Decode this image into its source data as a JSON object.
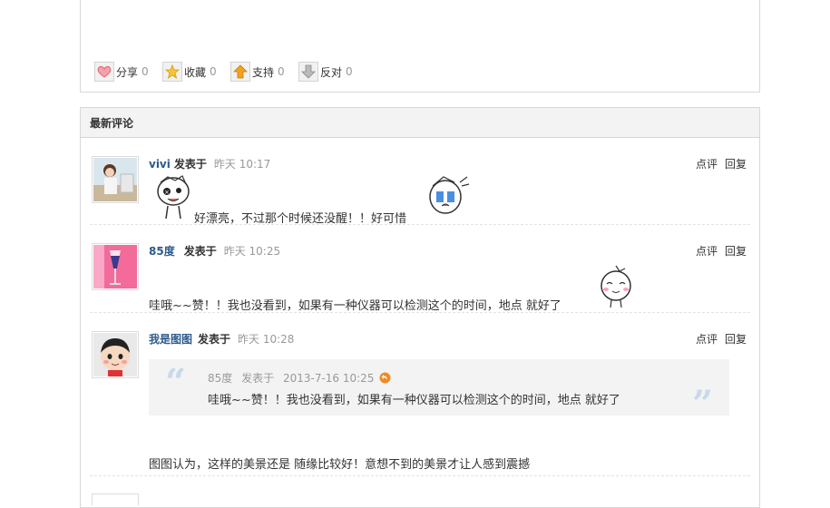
{
  "actions": [
    {
      "label": "分享",
      "count": "0",
      "icon": "heart-icon"
    },
    {
      "label": "收藏",
      "count": "0",
      "icon": "star-icon"
    },
    {
      "label": "支持",
      "count": "0",
      "icon": "arrow-up-icon"
    },
    {
      "label": "反对",
      "count": "0",
      "icon": "arrow-down-icon"
    }
  ],
  "comments_section": {
    "title": "最新评论",
    "comments": [
      {
        "user": "vivi",
        "posted_label": "发表于",
        "time": "昨天 10:17",
        "text": "好漂亮，不过那个时候还没醒！！好可惜",
        "ops": [
          "点评",
          "回复"
        ]
      },
      {
        "user": "85度",
        "posted_label": "发表于",
        "time": "昨天 10:25",
        "text": "哇哦~~赞！！我也没看到，如果有一种仪器可以检测这个的时间，地点 就好了",
        "ops": [
          "点评",
          "回复"
        ]
      },
      {
        "user": "我是图图",
        "posted_label": "发表于",
        "time": "昨天 10:28",
        "quote": {
          "user": "85度",
          "posted_label": "发表于",
          "time": "2013-7-16 10:25",
          "text": "哇哦~~赞！！我也没看到，如果有一种仪器可以检测这个的时间，地点 就好了"
        },
        "text": "图图认为，这样的美景还是 随缘比较好！意想不到的美景才让人感到震撼",
        "ops": [
          "点评",
          "回复"
        ]
      }
    ]
  },
  "colors": {
    "username": "#2c5a8c",
    "timestamp": "#999999",
    "quote_bg": "#f3f3f3",
    "accent": "#f08a24"
  }
}
